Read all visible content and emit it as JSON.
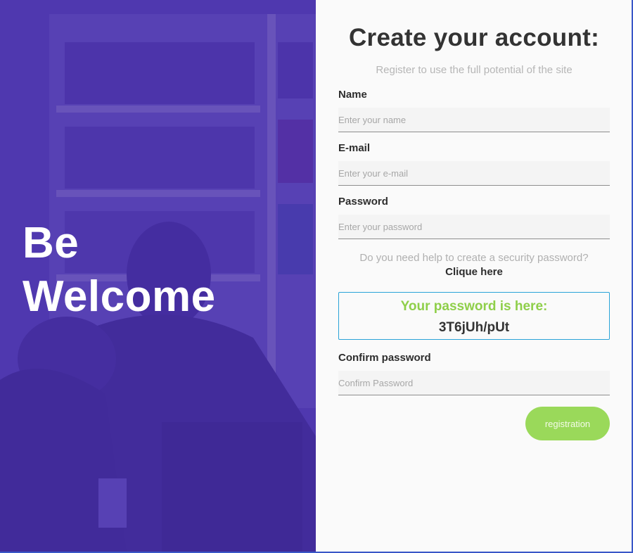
{
  "hero": {
    "title_line1": "Be",
    "title_line2": "Welcome"
  },
  "form": {
    "title": "Create your account:",
    "subtitle": "Register to use the full potential of the site",
    "name_label": "Name",
    "name_placeholder": "Enter your name",
    "email_label": "E-mail",
    "email_placeholder": "Enter your e-mail",
    "password_label": "Password",
    "password_placeholder": "Enter your password",
    "help_text": "Do you need help to create a security password?",
    "help_link": "Clique here",
    "generated_label": "Your password is here:",
    "generated_value": "3T6jUh/pUt",
    "confirm_label": "Confirm password",
    "confirm_placeholder": "Confirm Password",
    "submit_label": "registration"
  },
  "colors": {
    "hero_overlay": "#482eaa",
    "accent_green": "#9ad95a",
    "generated_label_green": "#8fcf4a",
    "box_border_blue": "#2aa3d8"
  }
}
